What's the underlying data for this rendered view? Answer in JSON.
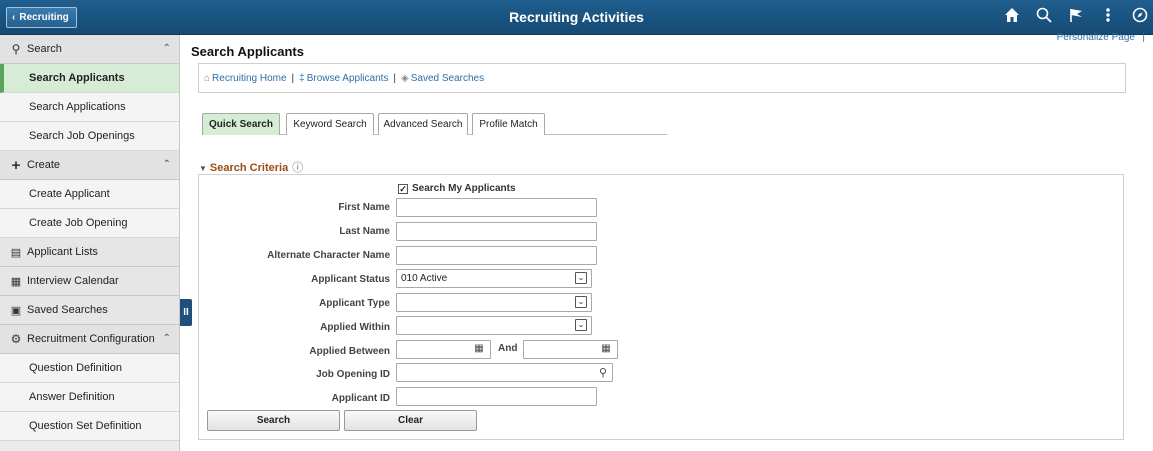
{
  "header": {
    "back_label": "Recruiting",
    "title": "Recruiting Activities",
    "icons": [
      "home-icon",
      "search-icon",
      "flag-icon",
      "more-icon",
      "navbar-icon"
    ]
  },
  "sidebar": {
    "sections": {
      "search": "Search",
      "search_items": [
        "Search Applicants",
        "Search Applications",
        "Search Job Openings"
      ],
      "create": "Create",
      "create_items": [
        "Create Applicant",
        "Create Job Opening"
      ],
      "applicant_lists": "Applicant Lists",
      "interview_calendar": "Interview Calendar",
      "saved_searches": "Saved Searches",
      "recruitment_config": "Recruitment Configuration",
      "config_items": [
        "Question Definition",
        "Answer Definition",
        "Question Set Definition"
      ]
    },
    "collapse_glyph": "II"
  },
  "main": {
    "personalize": "Personalize Page",
    "personalize_sep": "|",
    "page_title": "Search Applicants",
    "links": {
      "home": "Recruiting Home",
      "browse": "Browse Applicants",
      "saved": "Saved Searches",
      "sep": "|"
    },
    "tabs": [
      "Quick Search",
      "Keyword Search",
      "Advanced Search",
      "Profile Match"
    ],
    "criteria_heading": "Search Criteria",
    "search_my_applicants": "Search My Applicants",
    "search_my_applicants_checked": true,
    "fields": {
      "first_name": "First Name",
      "last_name": "Last Name",
      "alt_char_name": "Alternate Character Name",
      "applicant_status": "Applicant Status",
      "applicant_status_value": "010 Active",
      "applicant_type": "Applicant Type",
      "applied_within": "Applied Within",
      "applied_between": "Applied Between",
      "and": "And",
      "job_opening_id": "Job Opening ID",
      "applicant_id": "Applicant ID"
    },
    "buttons": {
      "search": "Search",
      "clear": "Clear"
    }
  },
  "colors": {
    "header_bg": "#1f5e8e",
    "active_tab": "#d5ecd5",
    "link": "#2f6ea8",
    "criteria_heading": "#9b4d13"
  }
}
